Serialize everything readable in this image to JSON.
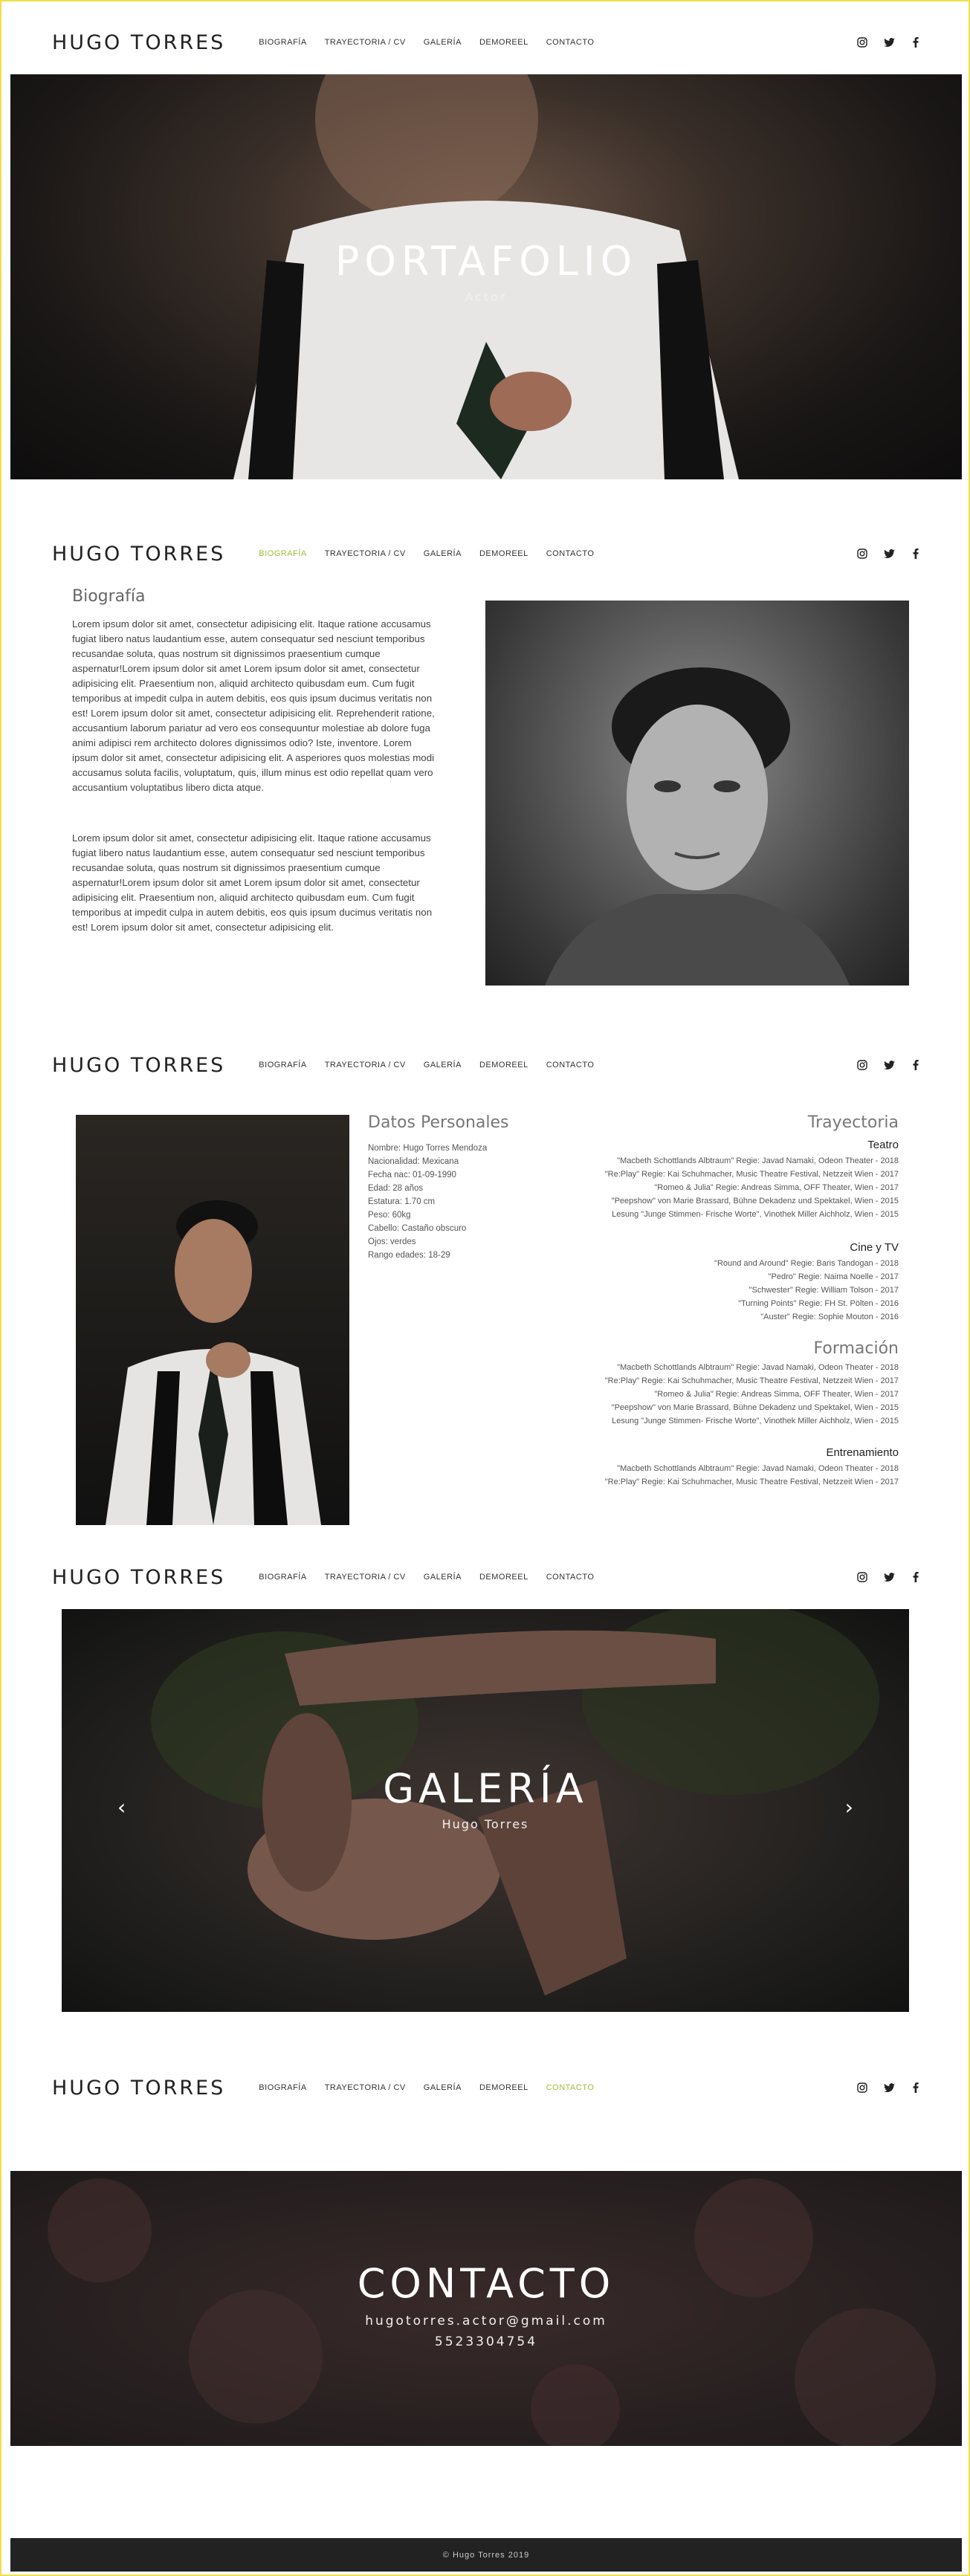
{
  "brand": "HUGO TORRES",
  "menu": [
    "BIOGRAFÍA",
    "TRAYECTORIA / CV",
    "GALERÍA",
    "DEMOREEL",
    "CONTACTO"
  ],
  "hero": {
    "title": "PORTAFOLIO",
    "subtitle": "Actor"
  },
  "bio": {
    "title": "Biografía",
    "p1": "Lorem ipsum dolor sit amet, consectetur adipisicing elit. Itaque ratione accusamus fugiat libero natus laudantium esse, autem consequatur sed nesciunt temporibus recusandae soluta, quas nostrum sit dignissimos praesentium cumque aspernatur!Lorem ipsum dolor sit amet Lorem ipsum dolor sit amet, consectetur adipisicing elit. Praesentium non, aliquid architecto quibusdam eum. Cum fugit temporibus at impedit culpa in autem debitis, eos quis ipsum ducimus veritatis non est! Lorem ipsum dolor sit amet, consectetur adipisicing elit. Reprehenderit ratione, accusantium laborum pariatur ad vero eos consequuntur molestiae ab dolore fuga animi adipisci rem architecto dolores dignissimos odio? Iste, inventore. Lorem ipsum dolor sit amet, consectetur adipisicing elit. A asperiores quos molestias modi accusamus soluta facilis, voluptatum, quis, illum minus est odio repellat quam vero accusantium voluptatibus libero dicta atque.",
    "p2": "Lorem ipsum dolor sit amet, consectetur adipisicing elit. Itaque ratione accusamus fugiat libero natus laudantium esse, autem consequatur sed nesciunt temporibus recusandae soluta, quas nostrum sit dignissimos praesentium cumque aspernatur!Lorem ipsum dolor sit amet Lorem ipsum dolor sit amet, consectetur adipisicing elit. Praesentium non, aliquid architecto quibusdam eum. Cum fugit temporibus at impedit culpa in autem debitis, eos quis ipsum ducimus veritatis non est! Lorem ipsum dolor sit amet, consectetur adipisicing elit."
  },
  "datos": {
    "title": "Datos Personales",
    "items": [
      "Nombre: Hugo Torres Mendoza",
      "Nacionalidad: Mexicana",
      "Fecha nac: 01-09-1990",
      "Edad: 28 años",
      "Estatura: 1.70 cm",
      "Peso: 60kg",
      "Cabello: Castaño obscuro",
      "Ojos: verdes",
      "Rango edades: 18-29"
    ]
  },
  "cv": {
    "title": "Trayectoria",
    "teatro_title": "Teatro",
    "teatro": [
      "\"Macbeth Schottlands Albtraum\" Regie: Javad Namaki, Odeon Theater - 2018",
      "\"Re:Play\" Regie: Kai Schuhmacher, Music Theatre Festival, Netzzeit Wien - 2017",
      "\"Romeo & Julia\" Regie: Andreas Simma, OFF Theater, Wien - 2017",
      "\"Peepshow\" von Marie Brassard, Bühne Dekadenz und Spektakel, Wien - 2015",
      "Lesung \"Junge Stimmen- Frische Worte\", Vinothek Miller Aichholz, Wien - 2015"
    ],
    "cine_title": "Cine y TV",
    "cine": [
      "\"Round and Around\" Regie: Baris Tandogan - 2018",
      "\"Pedro\" Regie: Naima Noelle - 2017",
      "\"Schwester\" Regie: William Tolson - 2017",
      "\"Turning Points\" Regie: FH St. Pölten - 2016",
      "\"Auster\" Regie: Sophie Mouton - 2016"
    ],
    "formacion_title": "Formación",
    "formacion": [
      "\"Macbeth Schottlands Albtraum\" Regie: Javad Namaki, Odeon Theater - 2018",
      "\"Re:Play\" Regie: Kai Schuhmacher, Music Theatre Festival, Netzzeit Wien - 2017",
      "\"Romeo & Julia\" Regie: Andreas Simma, OFF Theater, Wien - 2017",
      "\"Peepshow\" von Marie Brassard, Bühne Dekadenz und Spektakel, Wien - 2015",
      "Lesung \"Junge Stimmen- Frische Worte\", Vinothek Miller Aichholz, Wien - 2015"
    ],
    "entrenamiento_title": "Entrenamiento",
    "entrenamiento": [
      "\"Macbeth Schottlands Albtraum\" Regie: Javad Namaki, Odeon Theater - 2018",
      "\"Re:Play\" Regie: Kai Schuhmacher, Music Theatre Festival, Netzzeit Wien - 2017"
    ]
  },
  "galeria": {
    "title": "GALERÍA",
    "subtitle": "Hugo Torres"
  },
  "contacto": {
    "title": "CONTACTO",
    "email": "hugotorres.actor@gmail.com",
    "phone": "5523304754"
  },
  "footer": "© Hugo Torres 2019",
  "colors": {
    "accent": "#9bbf3a",
    "footer_bg": "#222222"
  },
  "icons": [
    "instagram-icon",
    "twitter-icon",
    "facebook-icon"
  ]
}
